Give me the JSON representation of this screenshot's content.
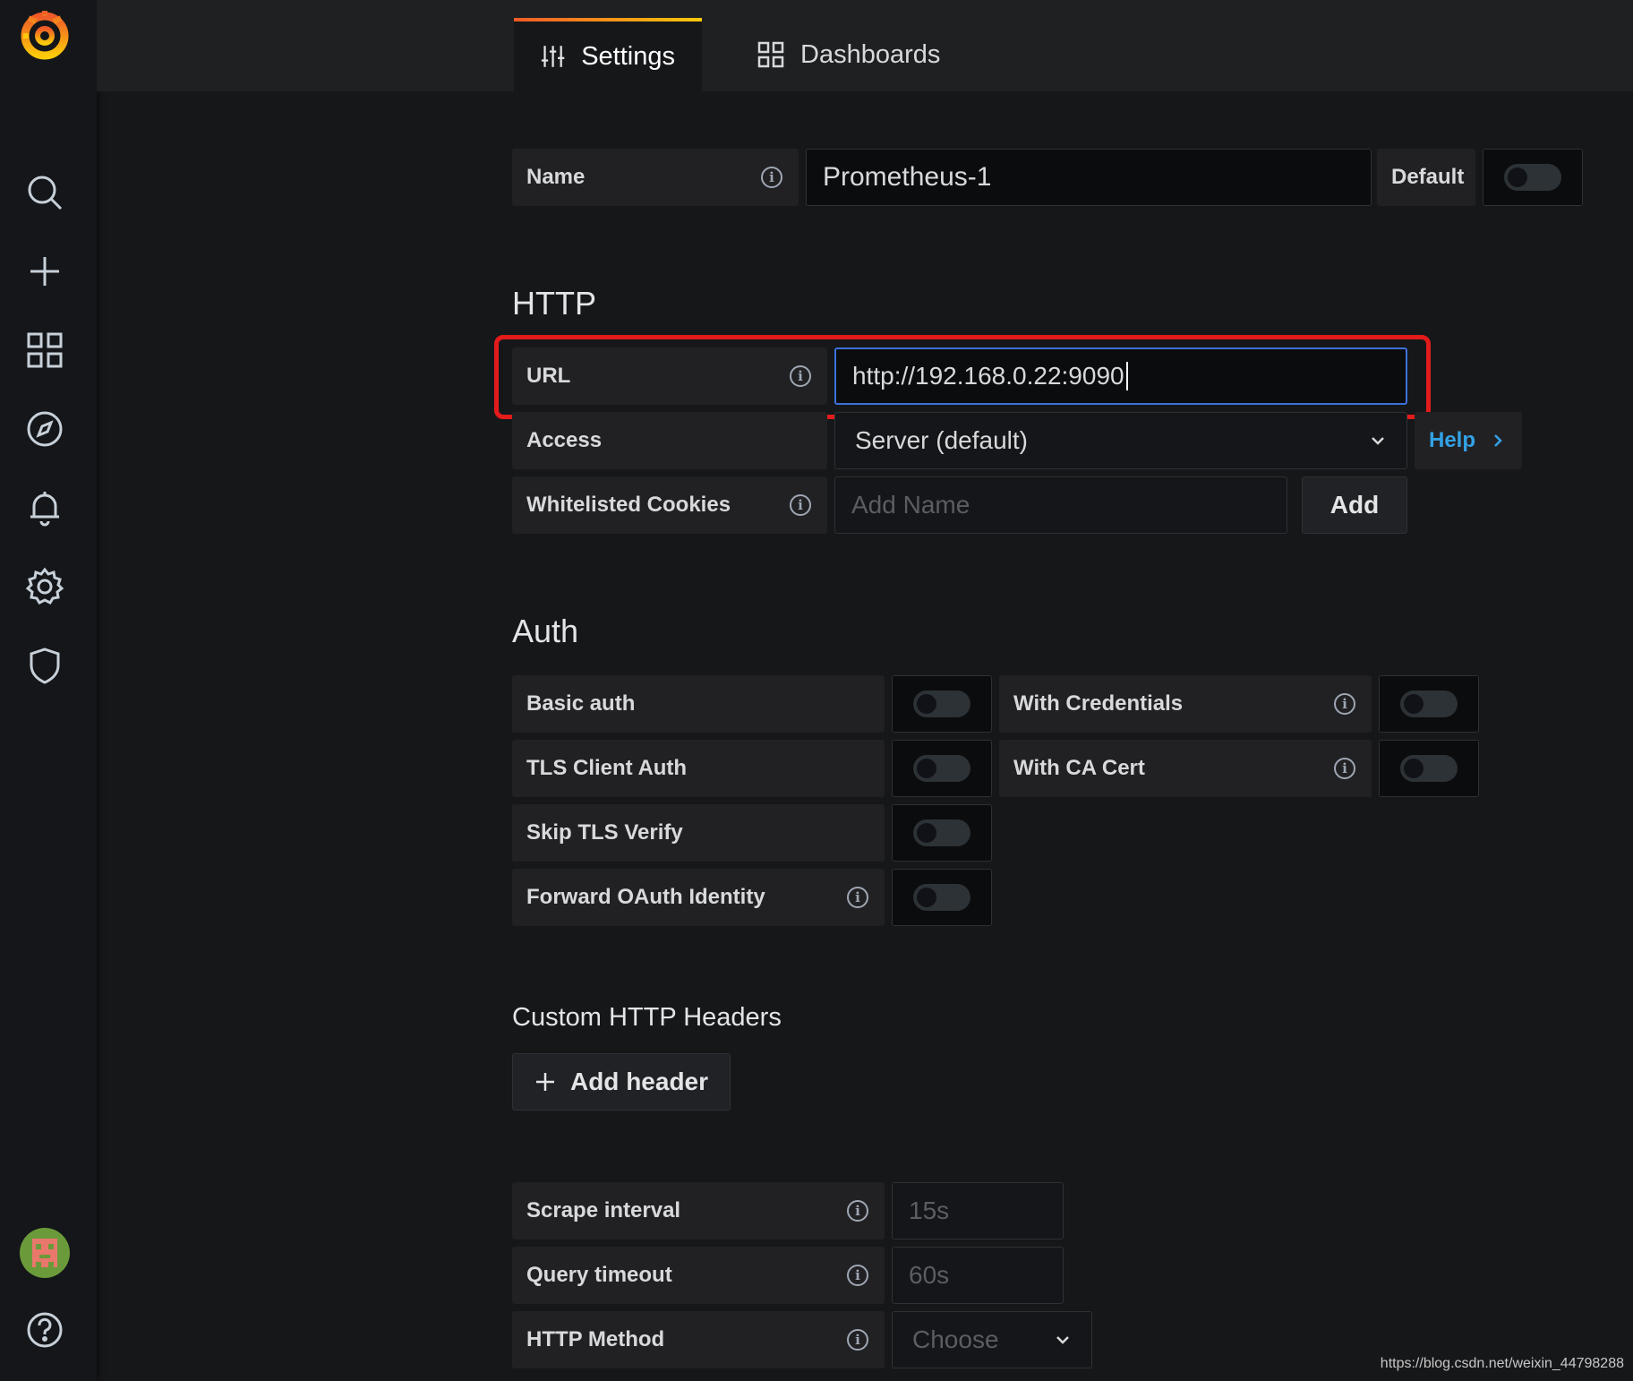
{
  "tabs": [
    {
      "label": "Settings",
      "icon": "sliders-icon",
      "active": true
    },
    {
      "label": "Dashboards",
      "icon": "grid-icon",
      "active": false
    }
  ],
  "name_row": {
    "label": "Name",
    "value": "Prometheus-1",
    "default_label": "Default"
  },
  "http": {
    "heading": "HTTP",
    "url": {
      "label": "URL",
      "value": "http://192.168.0.22:9090"
    },
    "access": {
      "label": "Access",
      "value": "Server (default)",
      "help": "Help"
    },
    "cookies": {
      "label": "Whitelisted Cookies",
      "placeholder": "Add Name",
      "add": "Add"
    }
  },
  "auth": {
    "heading": "Auth",
    "basic_auth": "Basic auth",
    "with_credentials": "With Credentials",
    "tls_client_auth": "TLS Client Auth",
    "with_ca_cert": "With CA Cert",
    "skip_tls_verify": "Skip TLS Verify",
    "forward_oauth": "Forward OAuth Identity"
  },
  "headers": {
    "heading": "Custom HTTP Headers",
    "add_header": "Add header"
  },
  "misc": {
    "scrape_interval": {
      "label": "Scrape interval",
      "placeholder": "15s"
    },
    "query_timeout": {
      "label": "Query timeout",
      "placeholder": "60s"
    },
    "http_method": {
      "label": "HTTP Method",
      "placeholder": "Choose"
    }
  },
  "watermark": "https://blog.csdn.net/weixin_44798288",
  "colors": {
    "accent_blue": "#33a2e5",
    "highlight_red": "#e31b1b",
    "brand_orange": "#f05a28"
  }
}
